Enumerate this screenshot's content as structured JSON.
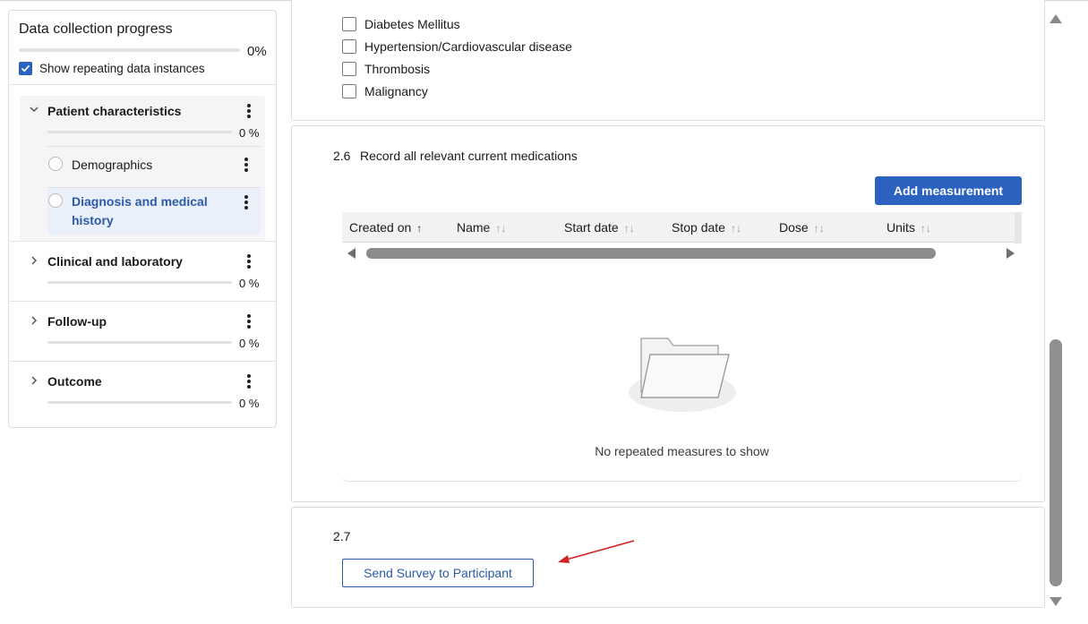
{
  "sidebar": {
    "title": "Data collection progress",
    "overall_progress_label": "0%",
    "overall_progress_value": 0,
    "show_repeating_label": "Show repeating data instances",
    "show_repeating_checked": true,
    "sections": [
      {
        "title": "Patient characteristics",
        "progress_label": "0 %",
        "progress_value": 0,
        "expanded": true,
        "subsections": [
          {
            "title": "Demographics",
            "active": false
          },
          {
            "title": "Diagnosis and medical history",
            "active": true
          }
        ]
      },
      {
        "title": "Clinical and laboratory",
        "progress_label": "0 %",
        "progress_value": 0,
        "expanded": false
      },
      {
        "title": "Follow-up",
        "progress_label": "0 %",
        "progress_value": 0,
        "expanded": false
      },
      {
        "title": "Outcome",
        "progress_label": "0 %",
        "progress_value": 0,
        "expanded": false
      }
    ]
  },
  "main": {
    "conditions": [
      {
        "label": "Diabetes Mellitus",
        "checked": false
      },
      {
        "label": "Hypertension/Cardiovascular disease",
        "checked": false
      },
      {
        "label": "Thrombosis",
        "checked": false
      },
      {
        "label": "Malignancy",
        "checked": false
      }
    ],
    "q26": {
      "number": "2.6",
      "text": "Record all relevant current medications",
      "add_button": "Add measurement",
      "columns": [
        "Created on",
        "Name",
        "Start date",
        "Stop date",
        "Dose",
        "Units"
      ],
      "sorted_column": "Created on",
      "empty_message": "No repeated measures to show"
    },
    "q27": {
      "number": "2.7",
      "button": "Send Survey to Participant"
    }
  },
  "colors": {
    "primary": "#2b62c0",
    "active_text": "#2b5aa8",
    "annotation_arrow": "#d42020"
  },
  "icons": {
    "chevron_down": "chevron-down-icon",
    "chevron_right": "chevron-right-icon",
    "kebab": "kebab-menu-icon",
    "sort": "sort-icon",
    "empty_folder": "empty-folder-icon"
  }
}
